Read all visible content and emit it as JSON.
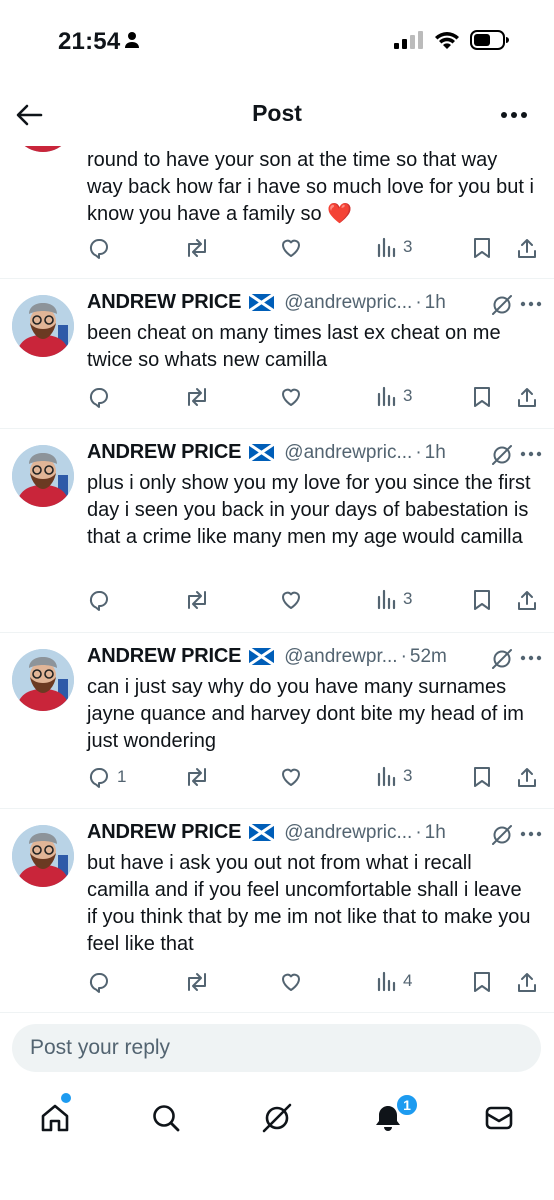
{
  "status_bar": {
    "time": "21:54"
  },
  "header": {
    "title": "Post"
  },
  "posts": [
    {
      "text": "round to have your son at the time so that way way back how far i have so much love for you but i know you have a family so ❤️",
      "reply_count": "",
      "view_count": "3"
    },
    {
      "author": "ANDREW PRICE",
      "handle": "@andrewpric...",
      "time": "1h",
      "text": "been cheat on many times last ex cheat on me twice so whats new camilla",
      "reply_count": "",
      "view_count": "3"
    },
    {
      "author": "ANDREW PRICE",
      "handle": "@andrewpric...",
      "time": "1h",
      "text": "plus i only show you my love for you since the first day i seen you back in your days of babestation is that a crime like many men my age would camilla",
      "reply_count": "",
      "view_count": "3"
    },
    {
      "author": "ANDREW PRICE",
      "handle": "@andrewpr...",
      "time": "52m",
      "text": "can i just say why do you have many surnames jayne quance and harvey dont bite my head of im just wondering",
      "reply_count": "1",
      "view_count": "3"
    },
    {
      "author": "ANDREW PRICE",
      "handle": "@andrewpric...",
      "time": "1h",
      "text": "but have i ask you out not from what i recall camilla and if you feel uncomfortable shall i leave if you think that by me im not like that to make you feel like that",
      "reply_count": "",
      "view_count": "4"
    }
  ],
  "separator": "·",
  "reply_bar": {
    "placeholder": "Post your reply"
  },
  "tabbar": {
    "notification_badge": "1"
  },
  "colors": {
    "accent": "#1d9bf0",
    "text": "#0f1419",
    "muted": "#536471",
    "heart": "#e0245e"
  },
  "icons": [
    "back-arrow-icon",
    "more-horizontal-icon",
    "reply-icon",
    "repost-icon",
    "like-icon",
    "views-icon",
    "bookmark-icon",
    "share-icon",
    "grok-icon",
    "home-icon",
    "search-icon",
    "notifications-icon",
    "messages-icon"
  ]
}
